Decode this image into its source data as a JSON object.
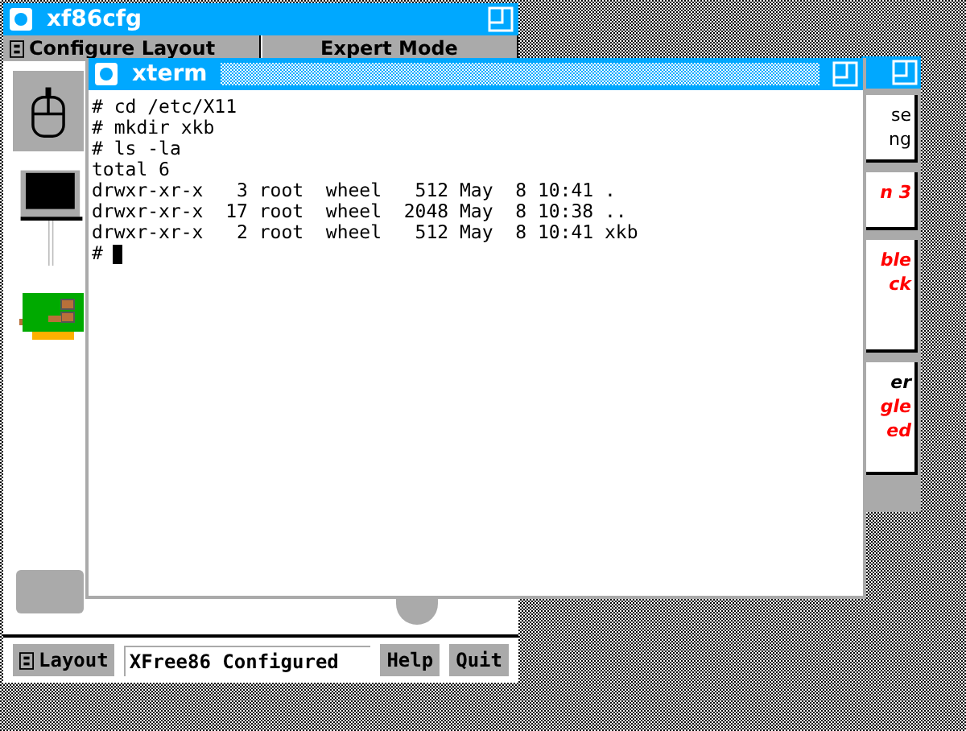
{
  "xf86cfg": {
    "title": "xf86cfg",
    "menu": [
      {
        "label": "Configure Layout"
      },
      {
        "label": "Expert Mode"
      }
    ],
    "layout_button": "Layout",
    "status": "XFree86 Configured",
    "buttons": [
      "Help",
      "Quit"
    ]
  },
  "back_window": {
    "cards": [
      {
        "lines": [
          {
            "text": "se",
            "kind": "plain"
          },
          {
            "text": "ng",
            "kind": "plain"
          }
        ]
      },
      {
        "lines": [
          {
            "text": "n 3",
            "kind": "warning"
          }
        ]
      },
      {
        "lines": [
          {
            "text": "ble",
            "kind": "warning"
          },
          {
            "text": "ck",
            "kind": "warning"
          }
        ]
      },
      {
        "lines": [
          {
            "text": "er",
            "kind": "heading"
          },
          {
            "text": "gle",
            "kind": "warning"
          },
          {
            "text": "ed",
            "kind": "warning"
          }
        ]
      }
    ]
  },
  "xterm": {
    "title": "xterm",
    "lines": [
      "# cd /etc/X11",
      "# mkdir xkb",
      "# ls -la",
      "total 6",
      "drwxr-xr-x   3 root  wheel   512 May  8 10:41 .",
      "drwxr-xr-x  17 root  wheel  2048 May  8 10:38 ..",
      "drwxr-xr-x   2 root  wheel   512 May  8 10:41 xkb",
      "#"
    ]
  }
}
